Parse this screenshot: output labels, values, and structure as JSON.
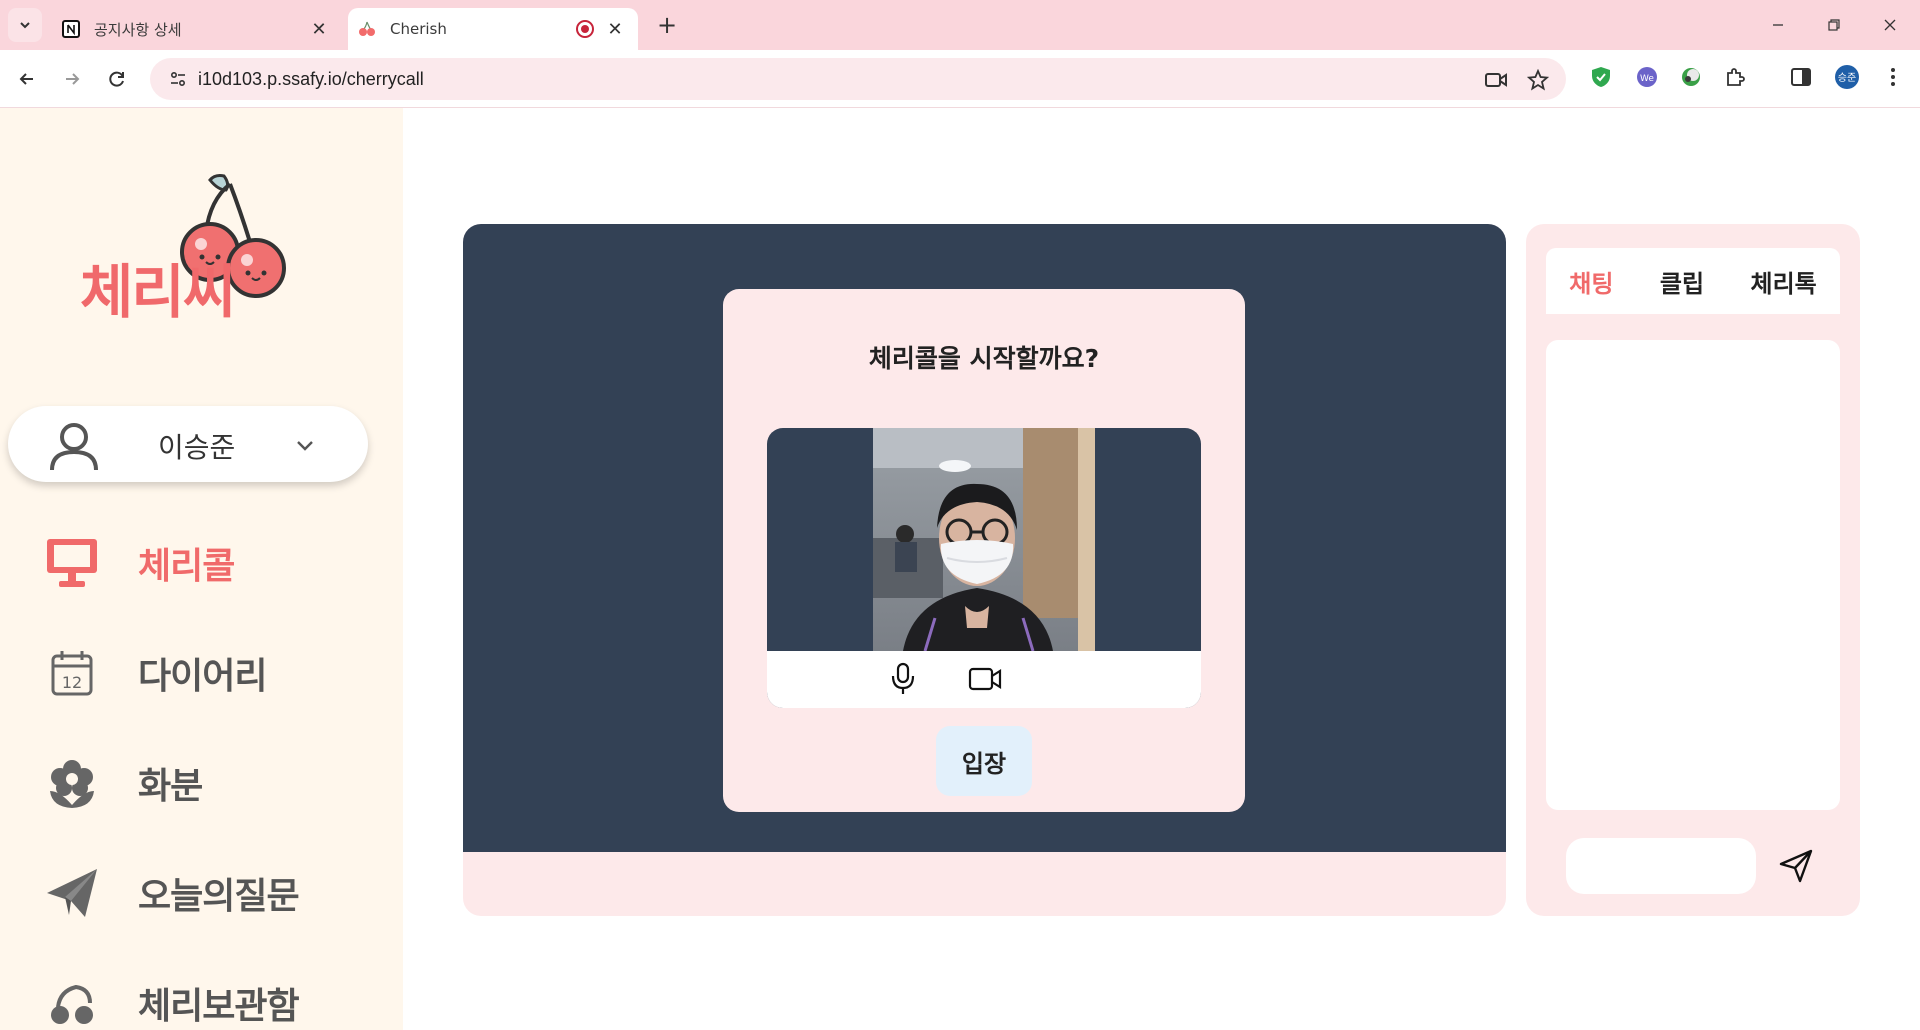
{
  "browser": {
    "tabs": [
      {
        "title": "공지사항 상세",
        "favicon": "notion-icon",
        "active": false
      },
      {
        "title": "Cherish",
        "favicon": "cherry-icon",
        "active": true,
        "recording": true
      }
    ],
    "url": "i10d103.p.ssafy.io/cherrycall",
    "profile_initials": "승준"
  },
  "sidebar": {
    "logo_text": "체리씨",
    "user_name": "이승준",
    "nav": [
      {
        "label": "체리콜",
        "icon": "monitor-icon",
        "active": true
      },
      {
        "label": "다이어리",
        "icon": "calendar-icon",
        "date": "12",
        "active": false
      },
      {
        "label": "화분",
        "icon": "flower-icon",
        "active": false
      },
      {
        "label": "오늘의질문",
        "icon": "paper-plane-icon",
        "active": false
      },
      {
        "label": "체리보관함",
        "icon": "cherry-box-icon",
        "active": false
      }
    ]
  },
  "main": {
    "modal_title": "체리콜을 시작할까요?",
    "enter_label": "입장"
  },
  "chat": {
    "tabs": [
      {
        "label": "채팅",
        "active": true
      },
      {
        "label": "클립",
        "active": false
      },
      {
        "label": "체리톡",
        "active": false
      }
    ],
    "input_placeholder": ""
  },
  "colors": {
    "accent": "#f06a6a",
    "tabbar": "#fad6dc",
    "sidebar_bg": "#fff7ec",
    "stage_dark": "#334155",
    "panel_pink": "#fde9ea",
    "enter_button": "#e2f0fb"
  }
}
